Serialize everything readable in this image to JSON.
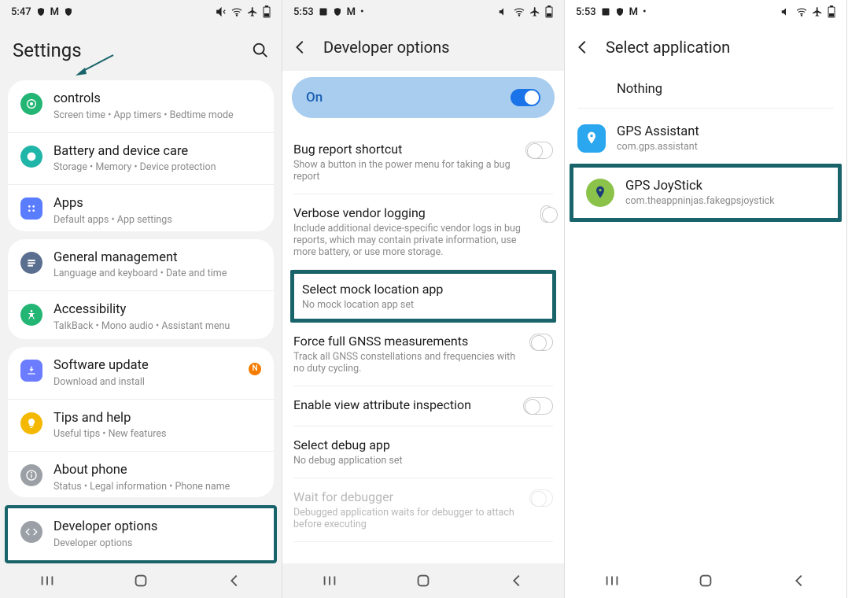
{
  "phone1": {
    "status": {
      "time": "5:47",
      "icons": "⬛ M ⬛",
      "right": "🔇 📶 ✈ 🔋"
    },
    "header": {
      "title": "Settings"
    },
    "groups": [
      {
        "items": [
          {
            "icon_bg": "#22b573",
            "title": "controls",
            "sub": "Screen time  •  App timers  •  Bedtime mode"
          },
          {
            "icon_bg": "#1fb5a8",
            "title": "Battery and device care",
            "sub": "Storage  •  Memory  •  Device protection"
          },
          {
            "icon_bg": "#5a7cff",
            "title": "Apps",
            "sub": "Default apps  •  App settings"
          }
        ]
      },
      {
        "items": [
          {
            "icon_bg": "#5a6e8f",
            "title": "General management",
            "sub": "Language and keyboard  •  Date and time"
          },
          {
            "icon_bg": "#22b573",
            "title": "Accessibility",
            "sub": "TalkBack  •  Mono audio  •  Assistant menu"
          }
        ]
      },
      {
        "items": [
          {
            "icon_bg": "#6b7cff",
            "title": "Software update",
            "sub": "Download and install",
            "badge": "N"
          },
          {
            "icon_bg": "#f5b800",
            "title": "Tips and help",
            "sub": "Useful tips  •  New features"
          },
          {
            "icon_bg": "#9aa0a6",
            "title": "About phone",
            "sub": "Status  •  Legal information  •  Phone name"
          }
        ]
      }
    ],
    "dev_row": {
      "title": "Developer options",
      "sub": "Developer options"
    }
  },
  "phone2": {
    "status": {
      "time": "5:53"
    },
    "header": {
      "title": "Developer options"
    },
    "on_label": "On",
    "items": [
      {
        "title": "Bug report shortcut",
        "sub": "Show a button in the power menu for taking a bug report",
        "toggle": "off"
      },
      {
        "title": "Verbose vendor logging",
        "sub": "Include additional device-specific vendor logs in bug reports, which may contain private information, use more battery, or use more storage.",
        "toggle": "off"
      }
    ],
    "highlight": {
      "title": "Select mock location app",
      "sub": "No mock location app set"
    },
    "items2": [
      {
        "title": "Force full GNSS measurements",
        "sub": "Track all GNSS constellations and frequencies with no duty cycling.",
        "toggle": "off"
      },
      {
        "title": "Enable view attribute inspection",
        "sub": "",
        "toggle": "off"
      },
      {
        "title": "Select debug app",
        "sub": "No debug application set"
      },
      {
        "title": "Wait for debugger",
        "sub": "Debugged application waits for debugger to attach before executing",
        "toggle": "off",
        "disabled": true
      }
    ]
  },
  "phone3": {
    "status": {
      "time": "5:53"
    },
    "header": {
      "title": "Select application"
    },
    "nothing_label": "Nothing",
    "apps": [
      {
        "name": "GPS Assistant",
        "pkg": "com.gps.assistant",
        "icon_bg": "#2aa7ee"
      },
      {
        "name": "GPS JoyStick",
        "pkg": "com.theappninjas.fakegpsjoystick",
        "icon_bg": "#8bc34a",
        "highlight": true
      }
    ]
  }
}
